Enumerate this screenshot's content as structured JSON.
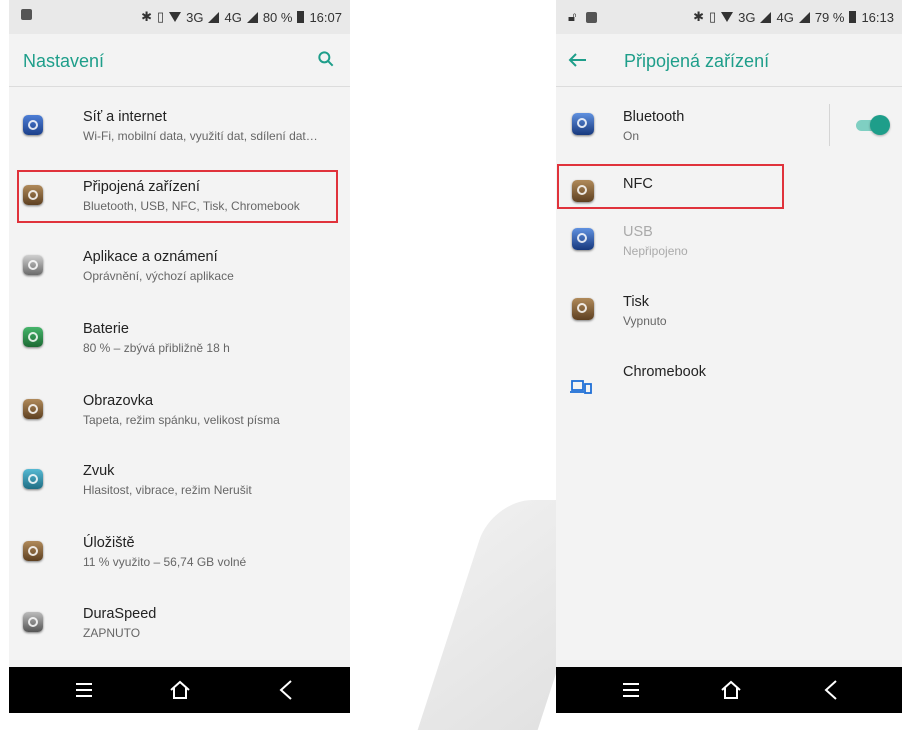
{
  "left": {
    "status": {
      "battery": "80 %",
      "time": "16:07",
      "net1": "3G",
      "net2": "4G"
    },
    "appbar": {
      "title": "Nastavení"
    },
    "items": [
      {
        "title": "Síť a internet",
        "sub": "Wi-Fi, mobilní data, využití dat, sdílení dat…"
      },
      {
        "title": "Připojená zařízení",
        "sub": "Bluetooth, USB, NFC, Tisk, Chromebook"
      },
      {
        "title": "Aplikace a oznámení",
        "sub": "Oprávnění, výchozí aplikace"
      },
      {
        "title": "Baterie",
        "sub": "80 % – zbývá přibližně 18 h"
      },
      {
        "title": "Obrazovka",
        "sub": "Tapeta, režim spánku, velikost písma"
      },
      {
        "title": "Zvuk",
        "sub": "Hlasitost, vibrace, režim Nerušit"
      },
      {
        "title": "Úložiště",
        "sub": "11 % využito – 56,74 GB volné"
      },
      {
        "title": "DuraSpeed",
        "sub": "ZAPNUTO"
      }
    ]
  },
  "right": {
    "status": {
      "battery": "79 %",
      "time": "16:13",
      "net1": "3G",
      "net2": "4G"
    },
    "appbar": {
      "title": "Připojená zařízení"
    },
    "items": [
      {
        "title": "Bluetooth",
        "sub": "On"
      },
      {
        "title": "NFC",
        "sub": ""
      },
      {
        "title": "USB",
        "sub": "Nepřipojeno"
      },
      {
        "title": "Tisk",
        "sub": "Vypnuto"
      },
      {
        "title": "Chromebook",
        "sub": ""
      }
    ],
    "bluetooth_on": true
  },
  "colors": {
    "accent": "#1e9e8a",
    "highlight": "#e0323b"
  }
}
